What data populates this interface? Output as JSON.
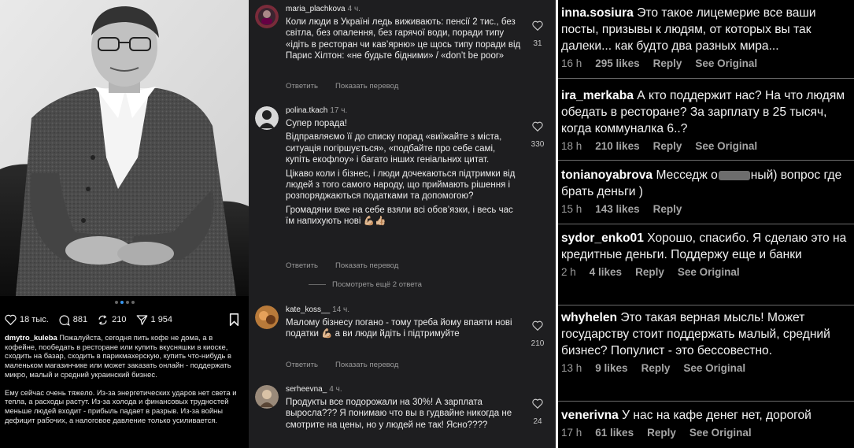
{
  "post": {
    "actions": {
      "likes": "18 тыс.",
      "comments": "881",
      "reposts": "210",
      "shares": "1 954"
    },
    "caption": {
      "username": "dmytro_kuleba",
      "paragraph_1": "Пожалуйста, сегодня пить кофе не дома, а в кофейне, пообедать в ресторане или купить вкусняшки в киоске, сходить на базар, сходить в парикмахерскую, купить что-нибудь в маленьком магазинчике или может заказать онлайн - поддержать микро, малый и средний украинский бизнес.",
      "paragraph_2": "Ему сейчас очень тяжело. Из-за энергетических ударов нет света и тепла, а расходы растут. Из-за холода и финансовых трудностей меньше людей входит - прибыль падает в разрыв. Из-за войны дефицит рабочих, а налоговое давление только усиливается."
    }
  },
  "panel2": {
    "reply_label": "Ответить",
    "translate_label": "Показать перевод",
    "view_replies": "Посмотреть ещё 2 ответа",
    "comments": [
      {
        "username": "maria_plachkova",
        "time": "4 ч.",
        "paragraphs": [
          "Коли люди  в Україні ледь виживають: пенсії 2 тис., без світла, без опалення, без гарячої води, поради типу «ідіть в ресторан чи кав’ярню» це  щось типу поради від Парис Хілтон: «не будьте бідними» / «don’t be poor»"
        ],
        "likes": "31"
      },
      {
        "username": "polina.tkach",
        "time": "17 ч.",
        "paragraphs": [
          "Супер порада!",
          "Відправляємо її до списку порад «виїжайте з міста, ситуація погіршується», «подбайте про себе самі, купіть екофлоу» і багато інших геніальних цитат.",
          "Цікаво коли і бізнес, і люди дочекаються підтримки від людей з того самого народу, що приймають рішення і розпоряджаються податками та допомогою?",
          "Громадяни вже на себе взяли всі обов’язки, і весь час їм напихують нові 💪🏼👍🏼"
        ],
        "likes": "330"
      },
      {
        "username": "kate_koss__",
        "time": "14 ч.",
        "paragraphs": [
          "Малому бізнесу погано - тому треба йому впаяти нові податки 💪🏼 а ви люди йдіть і підтримуйте"
        ],
        "likes": "210"
      },
      {
        "username": "serheevna_",
        "time": "4 ч.",
        "paragraphs": [
          "Продукты все подорожали на 30%! А зарплата выросла??? Я понимаю что вы в гудвайне никогда не смотрите на цены, но у людей не так! Ясно????"
        ],
        "likes": "24"
      }
    ]
  },
  "panel3": {
    "reply_label": "Reply",
    "see_original_label": "See Original",
    "comments": [
      {
        "username": "inna.sosiura",
        "text": "Это такое лицемерие все ваши посты, призывы к людям, от которых вы так далеки... как будто два разных мира...",
        "time": "16 h",
        "likes": "295 likes"
      },
      {
        "username": "ira_merkaba",
        "text": "А кто поддержит нас? На что людям обедать в ресторане? За зарплату в 25 тысяч, когда коммуналка 6..?",
        "time": "18 h",
        "likes": "210 likes"
      },
      {
        "username": "tonianoyabrova",
        "text_before": "Месседж о",
        "text_after": "ный) вопрос где брать деньги )",
        "time": "15 h",
        "likes": "143 likes"
      },
      {
        "username": "sydor_enko01",
        "text": "Хорошо, спасибо. Я сделаю это на кредитные деньги. Поддержу еще и банки",
        "time": "2 h",
        "likes": "4 likes"
      },
      {
        "username": "whyhelen",
        "text": "Это такая верная мысль! Может государству стоит поддержать малый, средний бизнес? Популист - это бессовестно.",
        "time": "13 h",
        "likes": "9 likes"
      },
      {
        "username": "venerivna",
        "text": "У нас на кафе денег нет, дорогой",
        "time": "17 h",
        "likes": "61 likes"
      }
    ]
  }
}
